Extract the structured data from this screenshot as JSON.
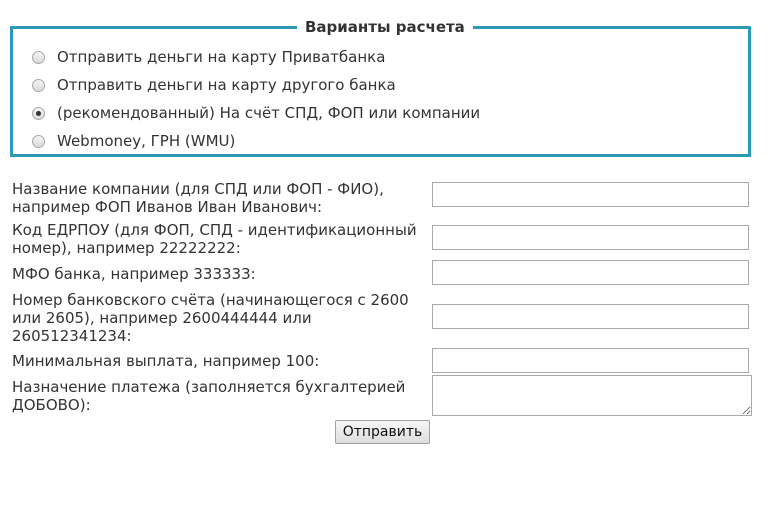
{
  "payment_options": {
    "legend": "Варианты расчета",
    "options": [
      {
        "label": "Отправить деньги на карту Приватбанка",
        "checked": false
      },
      {
        "label": "Отправить деньги на карту другого банка",
        "checked": false
      },
      {
        "label": "(рекомендованный) На счёт СПД, ФОП или компании",
        "checked": true
      },
      {
        "label": "Webmoney, ГРН (WMU)",
        "checked": false
      }
    ]
  },
  "form": {
    "company_name": {
      "label": "Название компании (для СПД или ФОП - ФИО), например ФОП Иванов Иван Иванович:",
      "value": ""
    },
    "edrpou": {
      "label": "Код ЕДРПОУ (для ФОП, СПД - идентификационный номер), например 22222222:",
      "value": ""
    },
    "mfo": {
      "label": "МФО банка, например 333333:",
      "value": ""
    },
    "account": {
      "label": "Номер банковского счёта (начинающегося с 2600 или 2605), например 2600444444 или 260512341234:",
      "value": ""
    },
    "min_payout": {
      "label": "Минимальная выплата, например 100:",
      "value": ""
    },
    "purpose": {
      "label": "Назначение платежа (заполняется бухгалтерией ДОБОВО):",
      "value": ""
    },
    "submit_label": "Отправить"
  },
  "colors": {
    "fieldset_border": "#2a9ab8",
    "text": "#333333"
  }
}
